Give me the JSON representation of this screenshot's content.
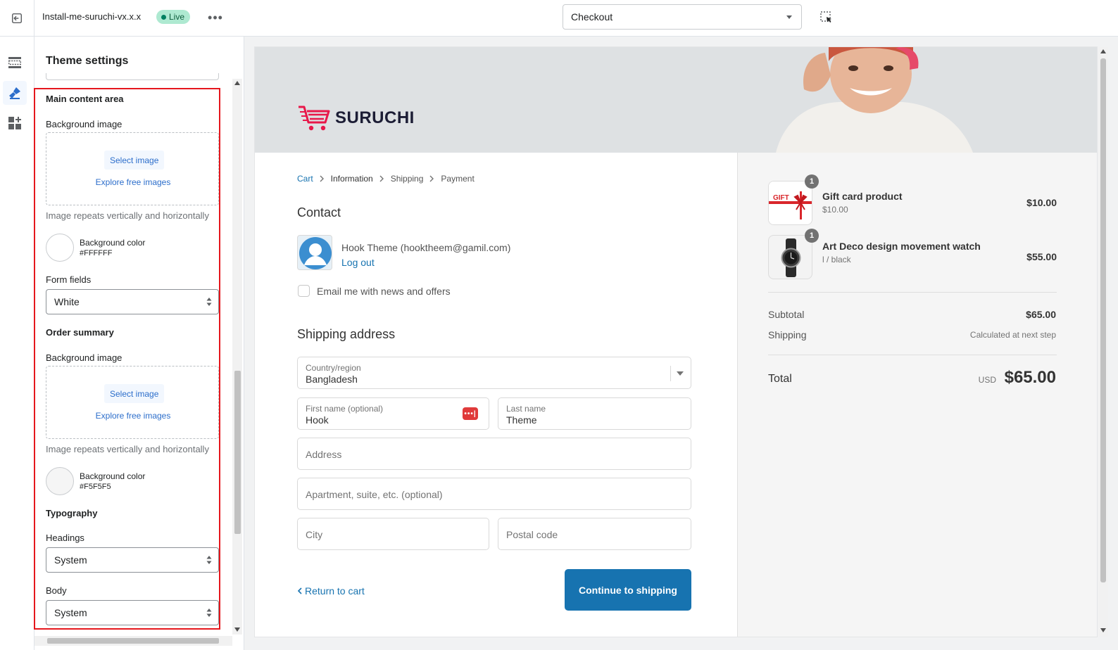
{
  "topbar": {
    "theme_name": "Install-me-suruchi-vx.x.x",
    "live_badge": "Live",
    "page_select": "Checkout"
  },
  "panel": {
    "title": "Theme settings",
    "main_content": {
      "heading": "Main content area",
      "bg_image_label": "Background image",
      "select_image": "Select image",
      "explore_free": "Explore free images",
      "repeat_help": "Image repeats vertically and horizontally",
      "bg_color_label": "Background color",
      "bg_color_value": "#FFFFFF",
      "form_fields_label": "Form fields",
      "form_fields_value": "White"
    },
    "order_summary": {
      "heading": "Order summary",
      "bg_image_label": "Background image",
      "select_image": "Select image",
      "explore_free": "Explore free images",
      "repeat_help": "Image repeats vertically and horizontally",
      "bg_color_label": "Background color",
      "bg_color_value": "#F5F5F5"
    },
    "typography": {
      "heading": "Typography",
      "headings_label": "Headings",
      "headings_value": "System",
      "body_label": "Body",
      "body_value": "System"
    }
  },
  "preview": {
    "brand": "SURUCHI",
    "breadcrumbs": [
      "Cart",
      "Information",
      "Shipping",
      "Payment"
    ],
    "contact_heading": "Contact",
    "contact_name": "Hook Theme (hooktheem@gamil.com)",
    "logout": "Log out",
    "newsletter": "Email me with news and offers",
    "shipping_heading": "Shipping address",
    "country_label": "Country/region",
    "country_value": "Bangladesh",
    "first_name_label": "First name (optional)",
    "first_name_value": "Hook",
    "last_name_label": "Last name",
    "last_name_value": "Theme",
    "address_ph": "Address",
    "apartment_ph": "Apartment, suite, etc. (optional)",
    "city_ph": "City",
    "postal_ph": "Postal code",
    "return_link": "Return to cart",
    "continue_btn": "Continue to shipping",
    "items": [
      {
        "qty": "1",
        "title": "Gift card product",
        "sub": "$10.00",
        "price": "$10.00",
        "thumb_text": "GIFT"
      },
      {
        "qty": "1",
        "title": "Art Deco design movement watch",
        "sub": "l / black",
        "price": "$55.00"
      }
    ],
    "subtotal_label": "Subtotal",
    "subtotal_value": "$65.00",
    "shipping_label": "Shipping",
    "shipping_value": "Calculated at next step",
    "total_label": "Total",
    "total_currency": "USD",
    "total_value": "$65.00"
  },
  "colors": {
    "accent": "#1773b0",
    "brand_pink": "#e8184a",
    "highlight_red": "#e5171d",
    "live_green": "#aee9d1"
  }
}
